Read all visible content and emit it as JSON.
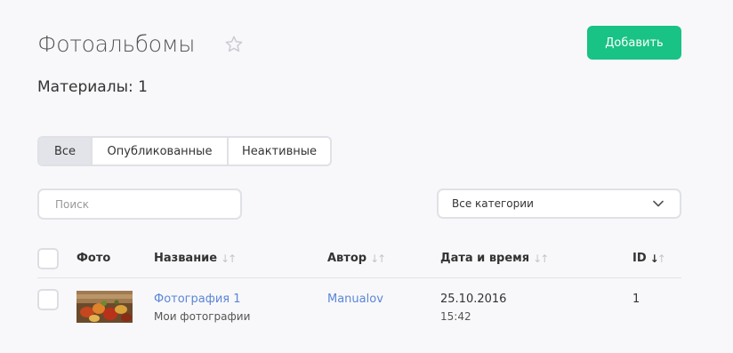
{
  "header": {
    "title": "Фотоальбомы",
    "add_label": "Добавить",
    "materials_label": "Материалы: 1"
  },
  "tabs": [
    {
      "label": "Все",
      "active": true
    },
    {
      "label": "Опубликованные",
      "active": false
    },
    {
      "label": "Неактивные",
      "active": false
    }
  ],
  "filters": {
    "search_placeholder": "Поиск",
    "category_value": "Все категории"
  },
  "table": {
    "columns": {
      "photo": "Фото",
      "name": "Название",
      "author": "Автор",
      "datetime": "Дата и время",
      "id": "ID"
    },
    "rows": [
      {
        "name": "Фотография 1",
        "album": "Мои фотографии",
        "author": "Manualov",
        "date": "25.10.2016",
        "time": "15:42",
        "id": "1"
      }
    ]
  },
  "colors": {
    "accent": "#19c285",
    "link": "#5b86d6",
    "background": "#f8f8fb"
  },
  "icons": {
    "star": "star-outline-icon",
    "chevron": "chevron-down-icon",
    "sort": "sort-arrows-icon"
  }
}
